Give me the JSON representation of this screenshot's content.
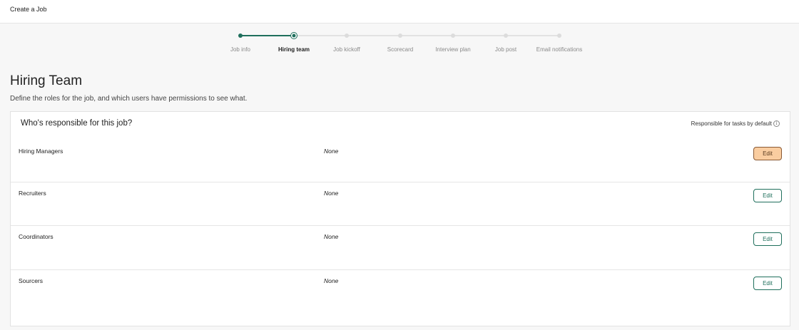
{
  "header": {
    "title": "Create a Job"
  },
  "stepper": {
    "steps": [
      {
        "label": "Job info",
        "state": "done"
      },
      {
        "label": "Hiring team",
        "state": "current"
      },
      {
        "label": "Job kickoff",
        "state": "todo"
      },
      {
        "label": "Scorecard",
        "state": "todo"
      },
      {
        "label": "Interview plan",
        "state": "todo"
      },
      {
        "label": "Job post",
        "state": "todo"
      },
      {
        "label": "Email notifications",
        "state": "todo"
      }
    ],
    "accent_color": "#1f6f5c"
  },
  "page": {
    "title": "Hiring Team",
    "subtitle": "Define the roles for the job, and which users have permissions to see what."
  },
  "card": {
    "title": "Who's responsible for this job?",
    "right_label": "Responsible for tasks by default",
    "info_icon": "info-icon",
    "roles": [
      {
        "name": "Hiring Managers",
        "value": "None",
        "action": "Edit"
      },
      {
        "name": "Recruiters",
        "value": "None",
        "action": "Edit"
      },
      {
        "name": "Coordinators",
        "value": "None",
        "action": "Edit"
      },
      {
        "name": "Sourcers",
        "value": "None",
        "action": "Edit"
      }
    ]
  },
  "highlight_color": "#f5a95f"
}
